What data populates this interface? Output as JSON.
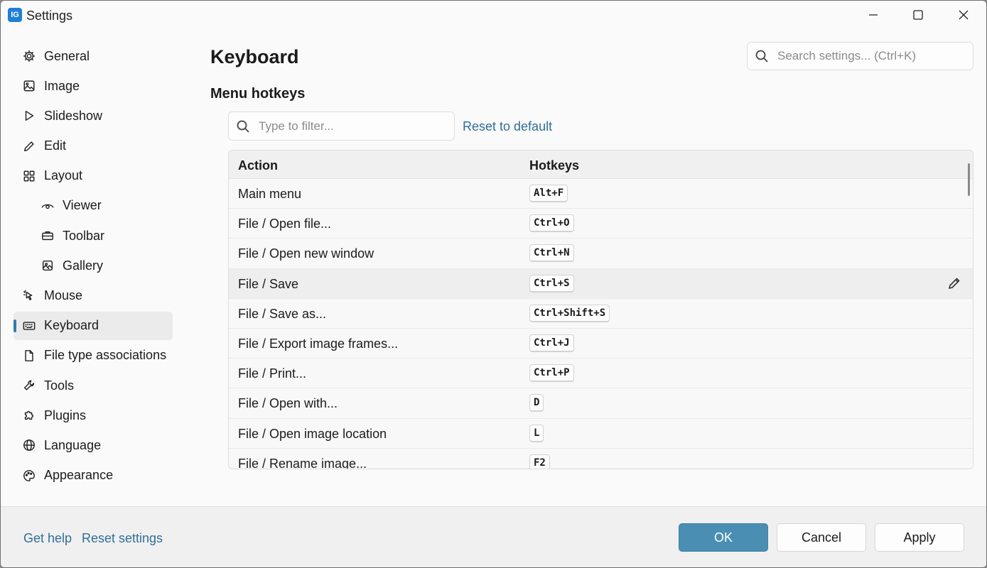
{
  "window": {
    "title": "Settings",
    "app_icon_letter": "IG"
  },
  "sidebar": {
    "items": [
      {
        "label": "General",
        "icon": "gear-icon",
        "sub": false,
        "active": false
      },
      {
        "label": "Image",
        "icon": "image-icon",
        "sub": false,
        "active": false
      },
      {
        "label": "Slideshow",
        "icon": "play-icon",
        "sub": false,
        "active": false
      },
      {
        "label": "Edit",
        "icon": "pencil-icon",
        "sub": false,
        "active": false
      },
      {
        "label": "Layout",
        "icon": "layout-grid-icon",
        "sub": false,
        "active": false
      },
      {
        "label": "Viewer",
        "icon": "eye-icon",
        "sub": true,
        "active": false
      },
      {
        "label": "Toolbar",
        "icon": "toolbox-icon",
        "sub": true,
        "active": false
      },
      {
        "label": "Gallery",
        "icon": "gallery-icon",
        "sub": true,
        "active": false
      },
      {
        "label": "Mouse",
        "icon": "mouse-pointer-icon",
        "sub": false,
        "active": false
      },
      {
        "label": "Keyboard",
        "icon": "keyboard-icon",
        "sub": false,
        "active": true
      },
      {
        "label": "File type associations",
        "icon": "file-icon",
        "sub": false,
        "active": false
      },
      {
        "label": "Tools",
        "icon": "wrench-icon",
        "sub": false,
        "active": false
      },
      {
        "label": "Plugins",
        "icon": "puzzle-icon",
        "sub": false,
        "active": false
      },
      {
        "label": "Language",
        "icon": "globe-icon",
        "sub": false,
        "active": false
      },
      {
        "label": "Appearance",
        "icon": "palette-icon",
        "sub": false,
        "active": false
      }
    ]
  },
  "main": {
    "page_title": "Keyboard",
    "section_title": "Menu hotkeys",
    "search_placeholder": "Search settings... (Ctrl+K)",
    "filter_placeholder": "Type to filter...",
    "reset_default_label": "Reset to default",
    "table": {
      "col_action": "Action",
      "col_hotkeys": "Hotkeys",
      "rows": [
        {
          "action": "Main menu",
          "hotkey": "Alt+F",
          "selected": false
        },
        {
          "action": "File / Open file...",
          "hotkey": "Ctrl+O",
          "selected": false
        },
        {
          "action": "File / Open new window",
          "hotkey": "Ctrl+N",
          "selected": false
        },
        {
          "action": "File / Save",
          "hotkey": "Ctrl+S",
          "selected": true
        },
        {
          "action": "File / Save as...",
          "hotkey": "Ctrl+Shift+S",
          "selected": false
        },
        {
          "action": "File / Export image frames...",
          "hotkey": "Ctrl+J",
          "selected": false
        },
        {
          "action": "File / Print...",
          "hotkey": "Ctrl+P",
          "selected": false
        },
        {
          "action": "File / Open with...",
          "hotkey": "D",
          "selected": false
        },
        {
          "action": "File / Open image location",
          "hotkey": "L",
          "selected": false
        },
        {
          "action": "File / Rename image...",
          "hotkey": "F2",
          "selected": false
        }
      ]
    }
  },
  "footer": {
    "get_help": "Get help",
    "reset_settings": "Reset settings",
    "ok": "OK",
    "cancel": "Cancel",
    "apply": "Apply"
  },
  "colors": {
    "accent": "#4a8fb3",
    "link": "#2f6f99",
    "active_indicator": "#2f7ea6"
  }
}
